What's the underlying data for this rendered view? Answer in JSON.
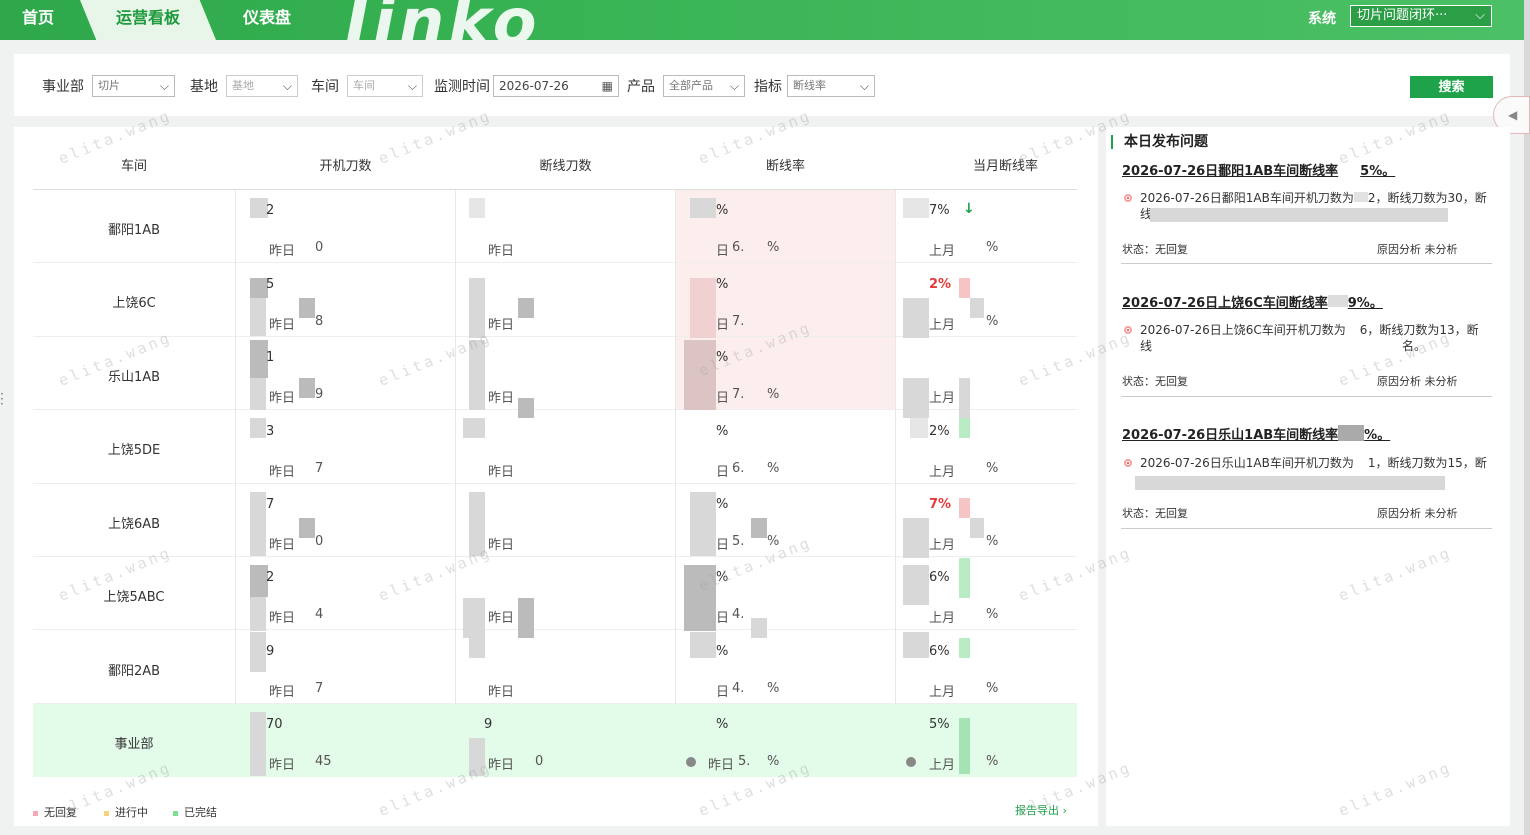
{
  "nav": {
    "tabs": [
      {
        "label": "首页"
      },
      {
        "label": "运营看板"
      },
      {
        "label": "仪表盘"
      }
    ],
    "logo_text": "Jinko",
    "system_label": "系统",
    "system_select": "切片问题闭环···"
  },
  "filters": {
    "division_label": "事业部",
    "division_value": "切片",
    "base_label": "基地",
    "base_placeholder": "基地",
    "workshop_label": "车间",
    "workshop_placeholder": "车间",
    "monitor_time_label": "监测时间",
    "monitor_time_value": "2026-07-26",
    "product_label": "产品",
    "product_value": "全部产品",
    "indicator_label": "指标",
    "indicator_value": "断线率",
    "search_label": "搜索"
  },
  "table": {
    "headers": [
      "车间",
      "开机刀数",
      "断线刀数",
      "断线率",
      "当月断线率"
    ],
    "rows": [
      {
        "name": "鄱阳1AB",
        "start": "2",
        "start_yd": "0",
        "break": "",
        "rate": "%",
        "rate_yd": "6.",
        "rate_yd_suffix": "%",
        "month": "7%",
        "month_red": false,
        "month_yd": "%"
      },
      {
        "name": "上饶6C",
        "start": "5",
        "start_yd": "8",
        "break": "",
        "rate": "%",
        "rate_yd": "7.",
        "rate_yd_suffix": "",
        "month": "2%",
        "month_red": true,
        "month_yd": "%"
      },
      {
        "name": "乐山1AB",
        "start": "1",
        "start_yd": "9",
        "break": "",
        "rate": "%",
        "rate_yd": "7.",
        "rate_yd_suffix": "%",
        "month": "",
        "month_red": false,
        "month_yd": ""
      },
      {
        "name": "上饶5DE",
        "start": "3",
        "start_yd": "7",
        "break": "",
        "rate": "%",
        "rate_yd": "6.",
        "rate_yd_suffix": "%",
        "month": "2%",
        "month_red": false,
        "month_yd": "%"
      },
      {
        "name": "上饶6AB",
        "start": "7",
        "start_yd": "0",
        "break": "",
        "rate": "%",
        "rate_yd": "5.",
        "rate_yd_suffix": "%",
        "month": "7%",
        "month_red": true,
        "month_yd": "%"
      },
      {
        "name": "上饶5ABC",
        "start": "2",
        "start_yd": "4",
        "break": "",
        "rate": "%",
        "rate_yd": "4.",
        "rate_yd_suffix": "",
        "month": "6%",
        "month_red": false,
        "month_yd": "%"
      },
      {
        "name": "鄱阳2AB",
        "start": "9",
        "start_yd": "7",
        "break": "",
        "rate": "%",
        "rate_yd": "4.",
        "rate_yd_suffix": "%",
        "month": "6%",
        "month_red": false,
        "month_yd": "%"
      },
      {
        "name": "事业部",
        "start": "70",
        "start_yd": "45",
        "break": "9",
        "break_yd": "0",
        "rate": "%",
        "rate_yd": "5.",
        "rate_yd_suffix": "%",
        "month": "5%",
        "month_red": false,
        "month_yd": "%"
      }
    ],
    "yesterday_label": "昨日",
    "yesterday_short": "日",
    "last_month_label": "上月",
    "trend_arrow": "↓"
  },
  "legend": {
    "items": [
      {
        "label": "无回复",
        "color": "#f7a8b8"
      },
      {
        "label": "进行中",
        "color": "#f6d37a"
      },
      {
        "label": "已完结",
        "color": "#7be08f"
      }
    ],
    "export_label": "报告导出 ›"
  },
  "issues": {
    "title": "本日发布问题",
    "items": [
      {
        "title": "2026-07-26日鄱阳1AB车间断线率",
        "title_suffix": "5%。",
        "desc": "2026-07-26日鄱阳1AB车间开机刀数为",
        "desc_mid": "2，断线刀数为30，断",
        "desc2": "线",
        "status": "状态：无回复",
        "cause": "原因分析 未分析"
      },
      {
        "title": "2026-07-26日上饶6C车间断线率",
        "title_suffix": "9%。",
        "desc": "2026-07-26日上饶6C车间开机刀数为",
        "desc_mid": "6，断线刀数为13，断",
        "desc2": "线",
        "desc2_tail": "名。",
        "status": "状态：无回复",
        "cause": "原因分析 未分析"
      },
      {
        "title": "2026-07-26日乐山1AB车间断线率",
        "title_suffix": "%。",
        "desc": "2026-07-26日乐山1AB车间开机刀数为",
        "desc_mid": "1，断线刀数为15，断",
        "desc2": "",
        "status": "状态：无回复",
        "cause": "原因分析 未分析"
      }
    ]
  },
  "watermark": "elita.wang",
  "colors": {
    "brand": "#1ea34a",
    "alert": "#e83a3a"
  }
}
